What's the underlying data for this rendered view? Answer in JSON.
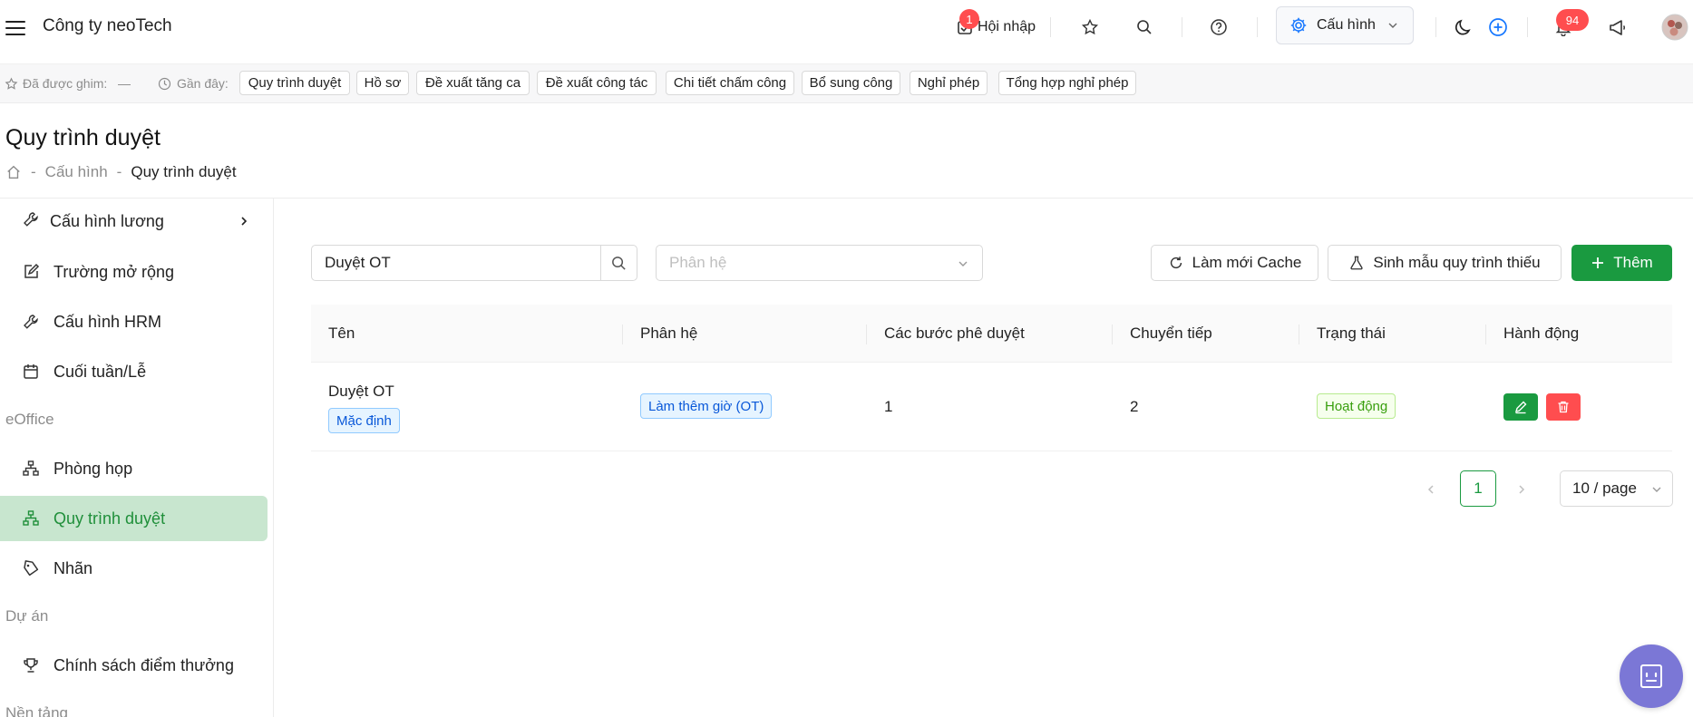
{
  "header": {
    "company": "Công ty neoTech",
    "checkin_label": "Hội nhập",
    "checkin_badge": "1",
    "config_label": "Cấu hình",
    "notification_badge": "94"
  },
  "pinbar": {
    "pinned_label": "Đã được ghim:",
    "pinned_empty": "—",
    "recent_label": "Gần đây:",
    "recent": [
      "Quy trình duyệt",
      "Hồ sơ",
      "Đề xuất tăng ca",
      "Đề xuất công tác",
      "Chi tiết chấm công",
      "Bổ sung công",
      "Nghỉ phép",
      "Tổng hợp nghỉ phép"
    ]
  },
  "page": {
    "title": "Quy trình duyệt",
    "breadcrumb": {
      "sep": "-",
      "parent": "Cấu hình",
      "current": "Quy trình duyệt"
    }
  },
  "sidebar": {
    "items": [
      {
        "label": "Cấu hình lương"
      },
      {
        "label": "Trường mở rộng"
      },
      {
        "label": "Cấu hình HRM"
      },
      {
        "label": "Cuối tuần/Lễ"
      },
      {
        "label": "Phòng họp"
      },
      {
        "label": "Quy trình duyệt"
      },
      {
        "label": "Nhãn"
      },
      {
        "label": "Chính sách điểm thưởng"
      }
    ],
    "groups": [
      "eOffice",
      "Dự án",
      "Nền tảng"
    ]
  },
  "filters": {
    "search_value": "Duyệt OT",
    "module_placeholder": "Phân hệ"
  },
  "actions": {
    "refresh": "Làm mới Cache",
    "generate": "Sinh mẫu quy trình thiếu",
    "add": "Thêm"
  },
  "table": {
    "columns": [
      "Tên",
      "Phân hệ",
      "Các bước phê duyệt",
      "Chuyển tiếp",
      "Trạng thái",
      "Hành động"
    ],
    "rows": [
      {
        "name": "Duyệt OT",
        "default_tag": "Mặc định",
        "module": "Làm thêm giờ (OT)",
        "steps": "1",
        "transitions": "2",
        "status": "Hoạt động"
      }
    ]
  },
  "pagination": {
    "current": "1",
    "page_size": "10 / page"
  },
  "colors": {
    "primary": "#1a9a40",
    "danger": "#ff4d4f",
    "active_bg": "#c8e6cf",
    "accent_blue": "#1677ff"
  }
}
